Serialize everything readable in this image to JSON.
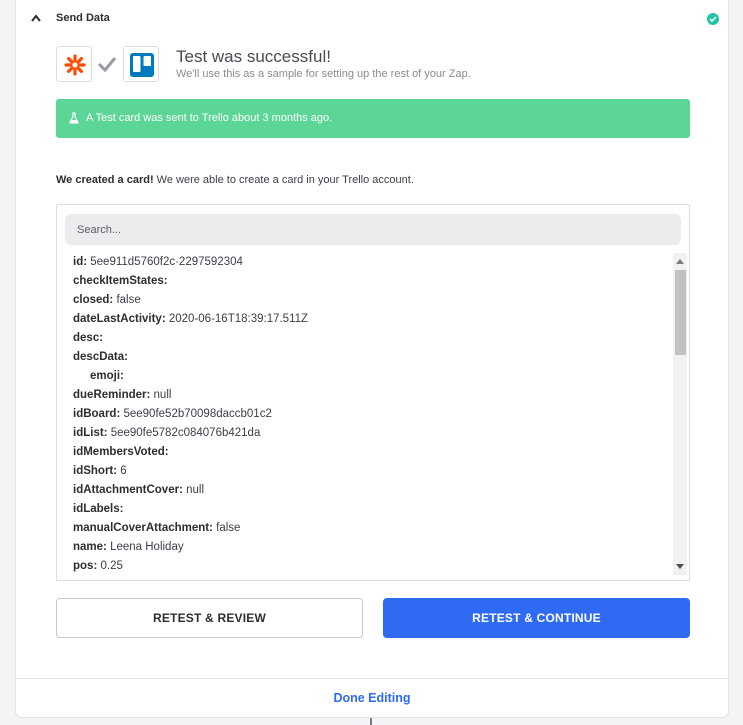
{
  "step": {
    "title": "Send Data",
    "status_icon": "success-check-icon"
  },
  "test": {
    "title": "Test was successful!",
    "subtitle": "We'll use this as a sample for setting up the rest of your Zap."
  },
  "banner": {
    "message": "A Test card was sent to Trello about 3 months ago."
  },
  "created": {
    "bold": "We created a card!",
    "rest": " We were able to create a card in your Trello account."
  },
  "search": {
    "placeholder": "Search..."
  },
  "fields": [
    {
      "key": "id:",
      "value": " 5ee911d5760f2c·2297592304"
    },
    {
      "key": "checkItemStates:",
      "value": ""
    },
    {
      "key": "closed:",
      "value": " false"
    },
    {
      "key": "dateLastActivity:",
      "value": " 2020-06-16T18:39:17.511Z"
    },
    {
      "key": "desc:",
      "value": ""
    },
    {
      "key": "descData:",
      "value": ""
    },
    {
      "key": "emoji:",
      "value": ""
    },
    {
      "key": "dueReminder:",
      "value": " null"
    },
    {
      "key": "idBoard:",
      "value": " 5ee90fe52b70098daccb01c2"
    },
    {
      "key": "idList:",
      "value": " 5ee90fe5782c084076b421da"
    },
    {
      "key": "idMembersVoted:",
      "value": ""
    },
    {
      "key": "idShort:",
      "value": " 6"
    },
    {
      "key": "idAttachmentCover:",
      "value": " null"
    },
    {
      "key": "idLabels:",
      "value": ""
    },
    {
      "key": "manualCoverAttachment:",
      "value": " false"
    },
    {
      "key": "name:",
      "value": " Leena Holiday"
    },
    {
      "key": "pos:",
      "value": " 0.25"
    }
  ],
  "buttons": {
    "retest_review": "RETEST & REVIEW",
    "retest_continue": "RETEST & CONTINUE"
  },
  "footer": {
    "done": "Done Editing"
  },
  "colors": {
    "banner": "#5cd697",
    "primary": "#2f6bf2",
    "success": "#22c3a6",
    "zapier": "#ff4a00",
    "trello": "#0079bf"
  }
}
